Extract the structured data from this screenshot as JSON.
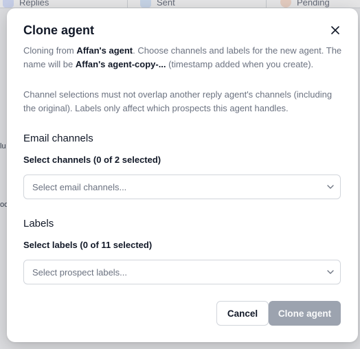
{
  "background": {
    "tabs": [
      {
        "label": "Replies",
        "icon": "chat-icon"
      },
      {
        "label": "Sent",
        "icon": "send-icon"
      },
      {
        "label": "Pending",
        "icon": "clock-icon"
      }
    ],
    "side_fragments": [
      "lu",
      "oo"
    ]
  },
  "modal": {
    "title": "Clone agent",
    "close_icon": "close-icon",
    "description": {
      "prefix": "Cloning from ",
      "source_agent": "Affan's agent",
      "middle": ". Choose channels and labels for the new agent. The name will be ",
      "new_name": "Affan's agent-copy-...",
      "suffix": " (timestamp added when you create)."
    },
    "note": "Channel selections must not overlap another reply agent's channels (including the original). Labels only affect which prospects this agent handles.",
    "email_section": {
      "title": "Email channels",
      "label": "Select channels (0 of 2 selected)",
      "placeholder": "Select email channels..."
    },
    "labels_section": {
      "title": "Labels",
      "label": "Select labels (0 of 11 selected)",
      "placeholder": "Select prospect labels..."
    },
    "buttons": {
      "cancel": "Cancel",
      "clone": "Clone agent"
    }
  },
  "colors": {
    "primary_text": "#111827",
    "muted_text": "#6b7280",
    "border": "#d1d5db",
    "disabled_button": "#9ca3af"
  }
}
